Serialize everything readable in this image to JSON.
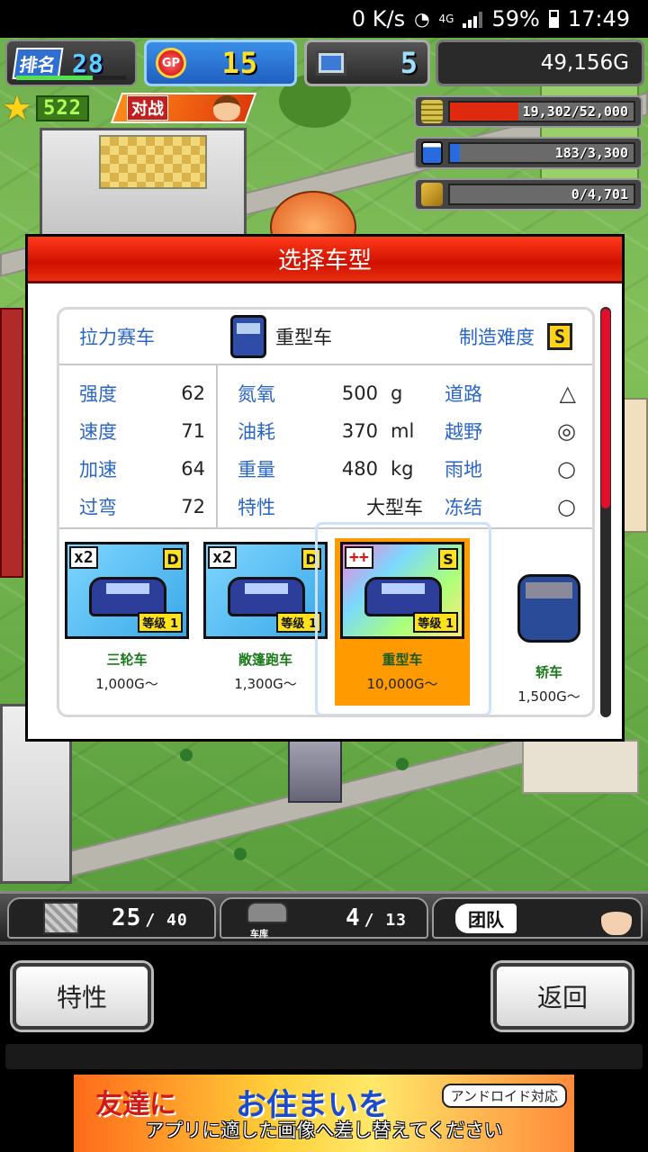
{
  "status_bar": {
    "net_speed": "0 K/s",
    "network": "4G",
    "battery": "59%",
    "time": "17:49"
  },
  "hud": {
    "rank_label": "排名",
    "rank": "28",
    "gp_label": "GP",
    "gp": "15",
    "pc": "5",
    "money": "49,156G",
    "stars": "522",
    "battle_label": "对战"
  },
  "resources": [
    {
      "icon": "coin-stack-icon",
      "text": "19,302/52,000",
      "fill": 0.371,
      "color": "#e02a10"
    },
    {
      "icon": "oil-bottle-icon",
      "text": "183/3,300",
      "fill": 0.055,
      "color": "#2a6ae0"
    },
    {
      "icon": "wheat-icon",
      "text": "0/4,701",
      "fill": 0.0,
      "color": "#999999"
    }
  ],
  "dialog": {
    "title": "选择车型",
    "category": "拉力赛车",
    "selected_type": "重型车",
    "difficulty_label": "制造难度",
    "difficulty_grade": "S",
    "stats": [
      {
        "label": "强度",
        "value": "62"
      },
      {
        "label": "速度",
        "value": "71"
      },
      {
        "label": "加速",
        "value": "64"
      },
      {
        "label": "过弯",
        "value": "72"
      }
    ],
    "specs": [
      {
        "label": "氮氧",
        "value": "500",
        "unit": "g",
        "terrain": "道路",
        "rating": "△"
      },
      {
        "label": "油耗",
        "value": "370",
        "unit": "ml",
        "terrain": "越野",
        "rating": "◎"
      },
      {
        "label": "重量",
        "value": "480",
        "unit": "kg",
        "terrain": "雨地",
        "rating": "○"
      },
      {
        "label": "特性",
        "value": "大型车",
        "unit": "",
        "terrain": "冻结",
        "rating": "○"
      }
    ],
    "cars": [
      {
        "name": "三轮车",
        "price": "1,000G〜",
        "multiplier": "x2",
        "grade": "D",
        "level_label": "等级",
        "level": "1"
      },
      {
        "name": "敞篷跑车",
        "price": "1,300G〜",
        "multiplier": "x2",
        "grade": "D",
        "level_label": "等级",
        "level": "1"
      },
      {
        "name": "重型车",
        "price": "10,000G〜",
        "multiplier": "++",
        "grade": "S",
        "level_label": "等级",
        "level": "1"
      },
      {
        "name": "轿车",
        "price": "1,500G〜"
      }
    ]
  },
  "tray": {
    "items_count": "25",
    "items_max": "40",
    "garage_label": "车库",
    "garage_count": "4",
    "garage_max": "13",
    "team_label": "团队"
  },
  "buttons": {
    "traits": "特性",
    "back": "返回"
  },
  "ad": {
    "line1": "友達に",
    "line2": "お住まいを",
    "tag": "アンドロイド対応",
    "caption": "アプリに適した画像へ差し替えてください"
  }
}
